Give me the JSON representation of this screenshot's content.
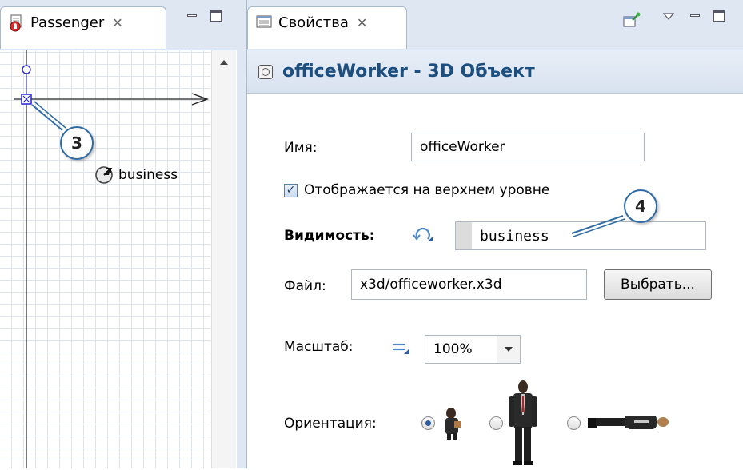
{
  "left_panel": {
    "tab_label": "Passenger",
    "canvas_label": "business"
  },
  "right_panel": {
    "tab_label": "Свойства",
    "header_title": "officeWorker - 3D Объект",
    "name_label": "Имя:",
    "name_value": "officeWorker",
    "top_level_checkbox_label": "Отображается на верхнем уровне",
    "top_level_checked": true,
    "visibility_label": "Видимость:",
    "visibility_value": "business",
    "file_label": "Файл:",
    "file_value": "x3d/officeworker.x3d",
    "choose_button_label": "Выбрать...",
    "scale_label": "Масштаб:",
    "scale_value": "100%",
    "orientation_label": "Ориентация:",
    "orientation_options": [
      "front-figure",
      "standing-figure",
      "lying-figure"
    ],
    "orientation_selected": 0
  },
  "callouts": {
    "c3": "3",
    "c4": "4"
  },
  "icons": [
    "passenger-agent-icon",
    "properties-icon",
    "pin-view-icon",
    "view-menu-icon",
    "minimize-icon",
    "maximize-icon",
    "cube-object-icon",
    "dynamic-value-icon",
    "static-value-icon",
    "dropdown-arrow-icon",
    "scroll-up-icon"
  ],
  "colors": {
    "header_text": "#1c4e80",
    "callout_border": "#2f6ca5",
    "tabbar_bg": "#dfe7f2"
  }
}
